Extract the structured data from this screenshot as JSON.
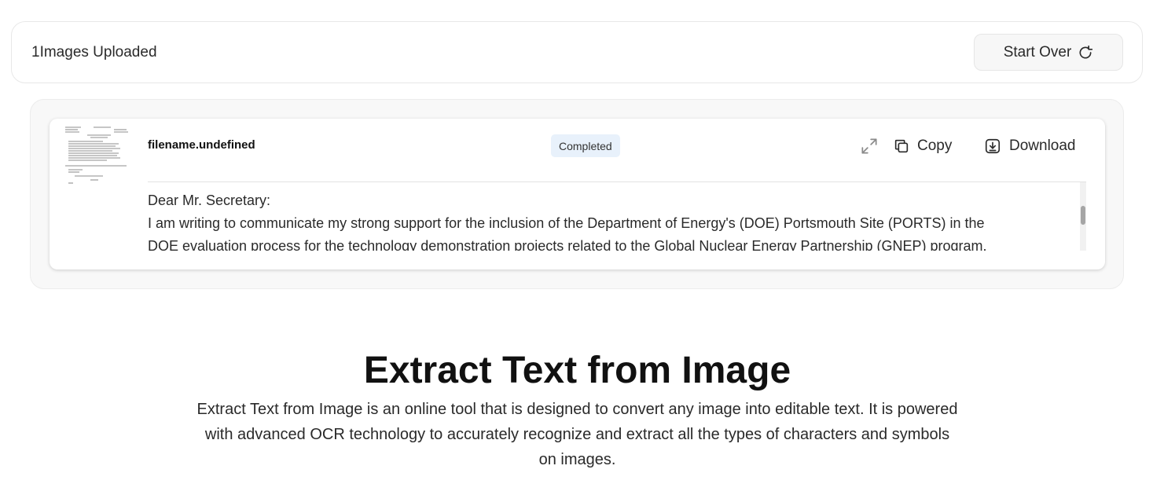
{
  "upload": {
    "count": "1",
    "label": "Images Uploaded",
    "start_over_label": "Start Over"
  },
  "result": {
    "filename": "filename.undefined",
    "status": "Completed",
    "copy_label": "Copy",
    "download_label": "Download",
    "text_lines": [
      "Dear Mr. Secretary:",
      "I am writing to communicate my strong support for the inclusion of the Department of Energy's (DOE) Portsmouth Site (PORTS) in the",
      "DOE evaluation process for the technology demonstration projects related to the Global Nuclear Energy Partnership (GNEP) program."
    ]
  },
  "hero": {
    "title": "Extract Text from Image",
    "description": "Extract Text from Image is an online tool that is designed to convert any image into editable text. It is powered with advanced OCR technology to accurately recognize and extract all the types of characters and symbols on images."
  },
  "icons": {
    "start_over": "refresh-icon",
    "expand": "expand-icon",
    "copy": "copy-icon",
    "download": "download-icon"
  }
}
